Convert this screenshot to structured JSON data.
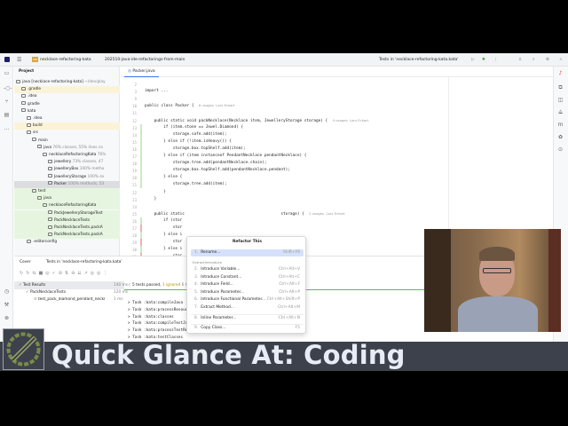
{
  "titlebar": {
    "project": "necklace-refactoring-kata",
    "project_badge": "NR",
    "branch": "202510-java-ide-refactorings-from-main",
    "run_config": "Tests in 'necklace-refactoring-kata.kata'"
  },
  "project_panel": {
    "title": "Project",
    "items": [
      {
        "label": "java [necklace-refactoring-kata]",
        "extra": "~/dev/play",
        "style": ""
      },
      {
        "label": ".gradle",
        "extra": "",
        "style": "hl"
      },
      {
        "label": ".idea",
        "extra": "",
        "style": ""
      },
      {
        "label": "gradle",
        "extra": "",
        "style": ""
      },
      {
        "label": "kata",
        "extra": "",
        "style": ""
      },
      {
        "label": ".idea",
        "extra": "",
        "style": ""
      },
      {
        "label": "build",
        "extra": "",
        "style": "hl"
      },
      {
        "label": "src",
        "extra": "",
        "style": ""
      },
      {
        "label": "main",
        "extra": "",
        "style": ""
      },
      {
        "label": "java",
        "extra": "76% classes, 55% lines co",
        "style": ""
      },
      {
        "label": "necklaceRefactoringKata",
        "extra": "76%",
        "style": ""
      },
      {
        "label": "jewellery",
        "extra": "73% classes, 47",
        "style": ""
      },
      {
        "label": "JewelleryBox",
        "extra": "100% metho",
        "style": ""
      },
      {
        "label": "JewelleryStorage",
        "extra": "100% ex",
        "style": ""
      },
      {
        "label": "Packer",
        "extra": "100% methods, 53",
        "style": "sel"
      },
      {
        "label": "test",
        "extra": "",
        "style": "grn"
      },
      {
        "label": "java",
        "extra": "",
        "style": "grn"
      },
      {
        "label": "necklaceRefactoringKata",
        "extra": "",
        "style": "grn"
      },
      {
        "label": "PackJewelleryStorageTest",
        "extra": "",
        "style": "grn"
      },
      {
        "label": "PackNecklaceTests",
        "extra": "",
        "style": "grn"
      },
      {
        "label": "PackNecklaceTests.packA",
        "extra": "",
        "style": "grn"
      },
      {
        "label": "PackNecklaceTests.packA",
        "extra": "",
        "style": "grn"
      },
      {
        "label": ".editorconfig",
        "extra": "",
        "style": ""
      }
    ]
  },
  "editor": {
    "tab": "Packer.java",
    "lines": [
      {
        "n": "2",
        "code": ""
      },
      {
        "n": "3",
        "code": "import ..."
      },
      {
        "n": "9",
        "code": ""
      },
      {
        "n": "10",
        "code": "public class Packer {",
        "hint": "6 usages  Lars Eckart"
      },
      {
        "n": "11",
        "code": ""
      },
      {
        "n": "12",
        "code": "    public static void packNecklace(Necklace item, JewelleryStorage storage) {",
        "hint": "4 usages  Lars Eckart"
      },
      {
        "n": "13",
        "code": "        if (item.stone == Jewel.Diamond) {"
      },
      {
        "n": "14",
        "code": "            storage.safe.add(item);"
      },
      {
        "n": "15",
        "code": "        } else if (!item.isHeavy()) {"
      },
      {
        "n": "16",
        "code": "            storage.box.topShelf.add(item);"
      },
      {
        "n": "17",
        "code": "        } else if (item instanceof PendantNecklace pendantNecklace) {"
      },
      {
        "n": "18",
        "code": "            storage.tree.add(pendantNecklace.chain);"
      },
      {
        "n": "19",
        "code": "            storage.box.topShelf.add(pendantNecklace.pendant);"
      },
      {
        "n": "20",
        "code": "        } else {"
      },
      {
        "n": "21",
        "code": "            storage.tree.add(item);"
      },
      {
        "n": "22",
        "code": "        }"
      },
      {
        "n": "23",
        "code": "    }"
      },
      {
        "n": "24",
        "code": ""
      },
      {
        "n": "25",
        "code": "    public static                                         storage) {",
        "hint": "2 usages  Lars Eckart"
      },
      {
        "n": "26",
        "code": "        if (stor"
      },
      {
        "n": "27",
        "code": "            stor"
      },
      {
        "n": "28",
        "code": "        } else i"
      },
      {
        "n": "29",
        "code": "            stor"
      },
      {
        "n": "30",
        "code": "        } else i                                           ace) {"
      },
      {
        "n": "31",
        "code": "            stor"
      }
    ]
  },
  "popup": {
    "title": "Refactor This",
    "section": "Extract/Introduce",
    "items": [
      {
        "n": "1.",
        "label": "Rename...",
        "shortcut": "Shift+F6"
      },
      {
        "n": "2.",
        "label": "Introduce Variable...",
        "shortcut": "Ctrl+Alt+V"
      },
      {
        "n": "3.",
        "label": "Introduce Constant...",
        "shortcut": "Ctrl+Alt+C"
      },
      {
        "n": "4.",
        "label": "Introduce Field...",
        "shortcut": "Ctrl+Alt+F"
      },
      {
        "n": "5.",
        "label": "Introduce Parameter...",
        "shortcut": "Ctrl+Alt+P"
      },
      {
        "n": "6.",
        "label": "Introduce Functional Parameter...",
        "shortcut": "Ctrl+Alt+Shift+P"
      },
      {
        "n": "7.",
        "label": "Extract Method...",
        "shortcut": "Ctrl+Alt+M"
      },
      {
        "n": "8.",
        "label": "Inline Parameter...",
        "shortcut": "Ctrl+Alt+N"
      },
      {
        "n": "9.",
        "label": "Copy Class...",
        "shortcut": "F5"
      }
    ]
  },
  "bottom": {
    "tab_cover": "Cover",
    "tab_tests": "Tests in 'necklace-refactoring-kata.kata'",
    "results": [
      {
        "label": "Test Results",
        "time": "140 ms"
      },
      {
        "label": "PackNecklaceTests",
        "time": "120 ms"
      },
      {
        "label": "test_pack_diamond_pendant_neckl",
        "time": "1 ms"
      }
    ],
    "status_passed": "5 tests passed,",
    "status_ignored": "1 ignored",
    "status_total": "6 tests total, 140 ms",
    "console": [
      "> Task :kata:compileJava",
      "> Task :kata:processResources NO-SOURCE",
      "> Task :kata:classes",
      "> Task :kata:compileTestJava",
      "> Task :kata:processTestResources NO-SOURCE",
      "> Task :kata:testClasses"
    ]
  },
  "banner": {
    "title": "Quick Glance At: Coding"
  }
}
